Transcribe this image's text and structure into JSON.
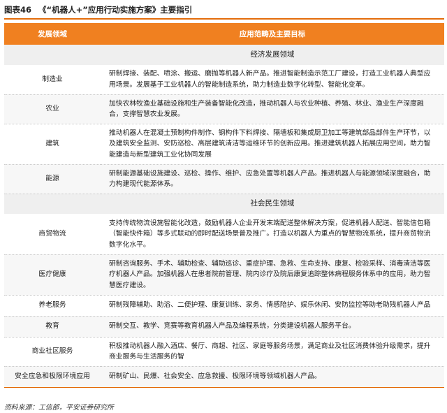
{
  "figure": {
    "label": "图表46",
    "title": "《“机器人+”应用行动实施方案》主要指引"
  },
  "table": {
    "headers": [
      "发展领域",
      "应用范畴及主要目标"
    ],
    "sections": [
      {
        "title": "经济发展领域",
        "rows": [
          {
            "area": "制造业",
            "desc": "研制焊接、装配、喷涂、搬运、磨抛等机器人新产品。推进智能制造示范工厂建设，打造工业机器人典型应用场景。发展基于工业机器人的智能制造系统，助力制造业数字化转型、智能化变革。"
          },
          {
            "area": "农业",
            "desc": "加快农林牧渔业基础设施和生产装备智能化改造，推动机器人与农业种植、养殖、林业、渔业生产深度融合，支撑智慧农业发展。"
          },
          {
            "area": "建筑",
            "desc": "推动机器人在混凝土预制构件制作、钢构件下料焊接、隔墙板和集成厨卫加工等建筑部品部件生产环节，以及建筑安全监测、安防巡检、高层建筑清洁等运维环节的创新应用。推进建筑机器人拓展应用空间，助力智能建造与新型建筑工业化协同发展"
          },
          {
            "area": "能源",
            "desc": "研制能源基础设施建设、巡检、操作、维护、应急处置等机器人产品。推进机器人与能源领域深度融合，助力构建现代能源体系。"
          }
        ]
      },
      {
        "title": "社会民生领域",
        "rows": [
          {
            "area": "商贸物流",
            "desc": "支持传统物流设施智能化改造，鼓励机器人企业开发末端配送整体解决方案，促进机器人配送、智能信包箱（智能快件箱）等多式联动的即时配送场景普及推广。打造以机器人为重点的智慧物流系统，提升商贸物流数字化水平。"
          },
          {
            "area": "医疗健康",
            "desc": "研制咨询服务、手术、辅助检查、辅助巡诊、重症护理、急救、生命支持、康复、检验采样、消毒清洁等医疗机器人产品。加强机器人在患者院前管理、院内诊疗及院后康复追踪整体病程服务体系中的应用，助力智慧医疗建设。"
          },
          {
            "area": "养老服务",
            "desc": "研制残障辅助、助浴、二便护理、康复训练、家务、情感陪护、娱乐休闲、安防监控等助老助残机器人产品"
          },
          {
            "area": "教育",
            "desc": "研制交互、教学、竞赛等教育机器人产品及编程系统，分类建设机器人服务平台。"
          },
          {
            "area": "商业社区服务",
            "desc": "积极推动机器人融入酒店、餐厅、商超、社区、家庭等服务场景，满足商业及社区消费体验升级需求，提升商业服务与生活服务的智"
          },
          {
            "area": "安全应急和极限环境应用",
            "desc": "研制矿山、民爆、社会安全、应急救援、极限环境等领域机器人产品。"
          }
        ]
      }
    ]
  },
  "source": "资料来源：工信部，平安证券研究所",
  "colors": {
    "accent": "#f08020",
    "rule": "#e46c0a",
    "section_bg": "#efefef",
    "row_shade": "#f7f7f7"
  }
}
